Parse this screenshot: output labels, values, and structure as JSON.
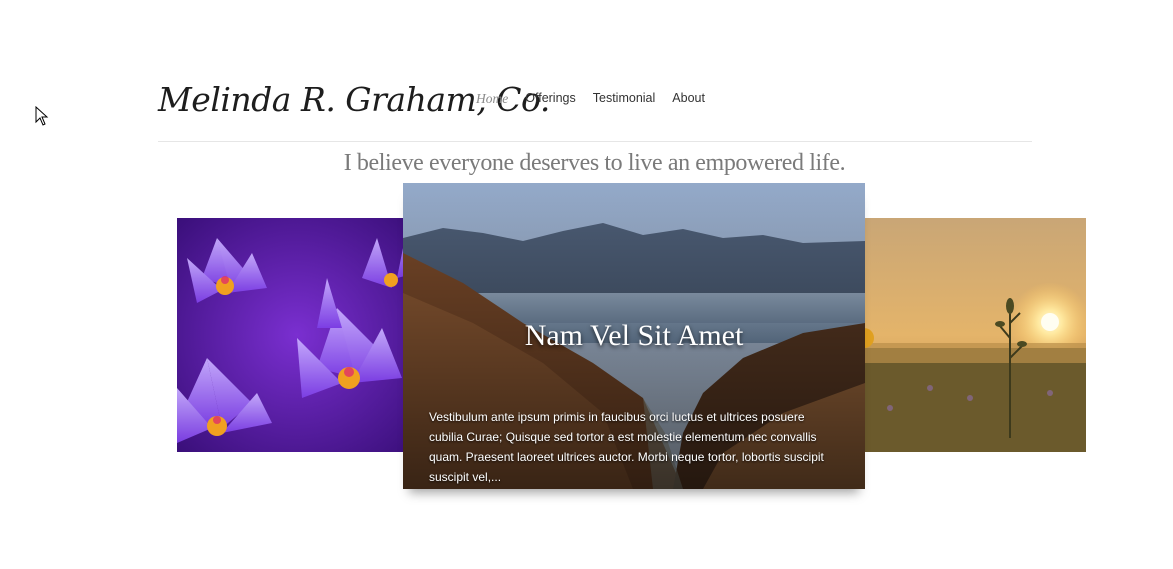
{
  "site": {
    "logo": "Melinda R. Graham, Co."
  },
  "nav": {
    "items": [
      {
        "label": "Home",
        "active": true
      },
      {
        "label": "Offerings",
        "active": false
      },
      {
        "label": "Testimonial",
        "active": false
      },
      {
        "label": "About",
        "active": false
      }
    ]
  },
  "tagline": "I believe everyone deserves to live an empowered life.",
  "slider": {
    "left_image": "purple-water-lilies-image",
    "right_image": "sunrise-meadow-image",
    "center": {
      "image": "mountain-valley-image",
      "title": "Nam Vel Sit Amet",
      "text": "Vestibulum ante ipsum primis in faucibus orci luctus et ultrices posuere cubilia Curae; Quisque sed tortor a est molestie elementum nec convallis quam. Praesent laoreet ultrices auctor. Morbi neque tortor, lobortis suscipit suscipit vel,..."
    }
  },
  "colors": {
    "nav_active": "#8a8a8a",
    "tagline": "#7a7a7a",
    "rule": "#e6e6e6"
  },
  "icons": {
    "cursor": "mouse-pointer-icon"
  }
}
